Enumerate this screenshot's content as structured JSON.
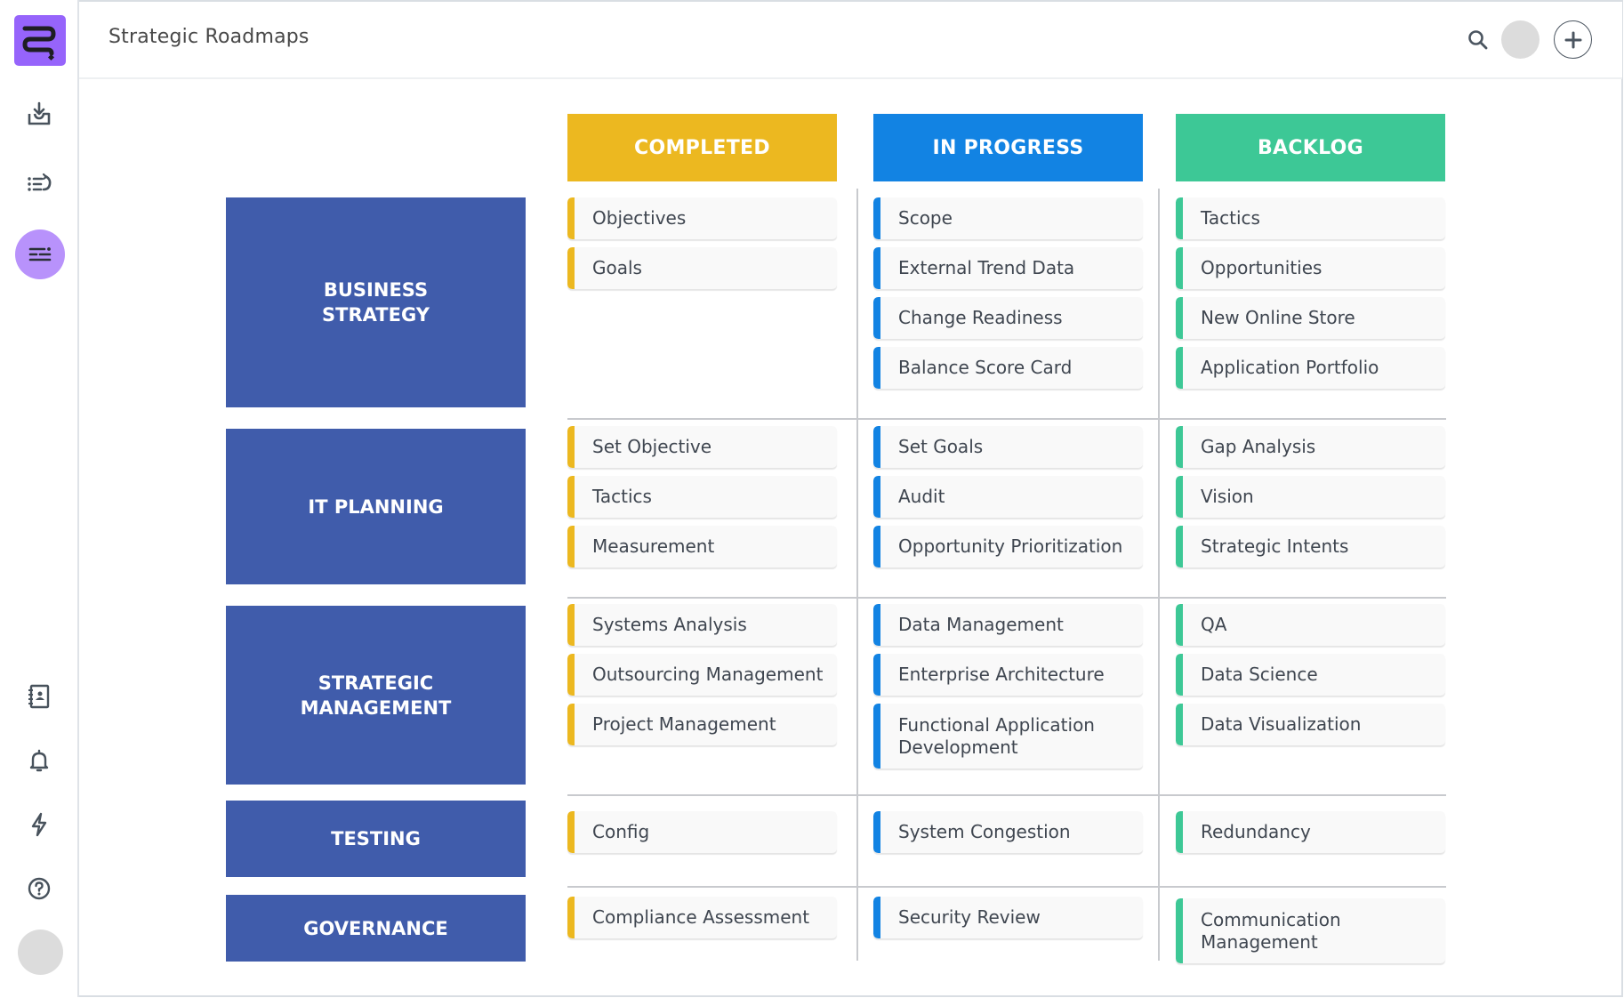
{
  "app": {
    "title": "Strategic Roadmaps",
    "logo_icon": "roadmap-logo-icon"
  },
  "sidebar": {
    "items": [
      {
        "name": "import",
        "icon": "inbox-download-icon",
        "active": false
      },
      {
        "name": "list",
        "icon": "list-undo-icon",
        "active": false
      },
      {
        "name": "roadmap",
        "icon": "roadmap-lines-icon",
        "active": true
      },
      {
        "name": "contacts",
        "icon": "contacts-book-icon",
        "active": false
      },
      {
        "name": "notifications",
        "icon": "bell-icon",
        "active": false
      },
      {
        "name": "actions",
        "icon": "lightning-icon",
        "active": false
      },
      {
        "name": "help",
        "icon": "help-circle-icon",
        "active": false
      }
    ],
    "avatar_icon": "user-avatar"
  },
  "header": {
    "search_icon": "search-icon",
    "avatar_icon": "user-avatar",
    "add_icon": "plus-circle-icon"
  },
  "colors": {
    "completed": "#ecb820",
    "in_progress": "#1283e3",
    "backlog": "#3dc896",
    "row_label": "#405cab",
    "logo": "#9664fb",
    "active_nav": "#b892fb"
  },
  "columns": [
    {
      "key": "completed",
      "label": "COMPLETED"
    },
    {
      "key": "in_progress",
      "label": "IN PROGRESS"
    },
    {
      "key": "backlog",
      "label": "BACKLOG"
    }
  ],
  "rows": [
    {
      "label": "BUSINESS\nSTRATEGY",
      "completed": [
        "Objectives",
        "Goals"
      ],
      "in_progress": [
        "Scope",
        "External Trend Data",
        "Change Readiness",
        "Balance Score Card"
      ],
      "backlog": [
        "Tactics",
        "Opportunities",
        "New Online Store",
        "Application Portfolio"
      ]
    },
    {
      "label": "IT PLANNING",
      "completed": [
        "Set Objective",
        "Tactics",
        "Measurement"
      ],
      "in_progress": [
        "Set Goals",
        "Audit",
        "Opportunity Prioritization"
      ],
      "backlog": [
        "Gap Analysis",
        "Vision",
        "Strategic Intents"
      ]
    },
    {
      "label": "STRATEGIC\nMANAGEMENT",
      "completed": [
        "Systems Analysis",
        "Outsourcing Management",
        "Project Management"
      ],
      "in_progress": [
        "Data Management",
        "Enterprise Architecture",
        "Functional Application Development"
      ],
      "backlog": [
        "QA",
        "Data Science",
        "Data Visualization"
      ]
    },
    {
      "label": "TESTING",
      "completed": [
        "Config"
      ],
      "in_progress": [
        "System Congestion"
      ],
      "backlog": [
        "Redundancy"
      ]
    },
    {
      "label": "GOVERNANCE",
      "completed": [
        "Compliance Assessment"
      ],
      "in_progress": [
        "Security Review"
      ],
      "backlog": [
        "Communication Management"
      ]
    }
  ]
}
